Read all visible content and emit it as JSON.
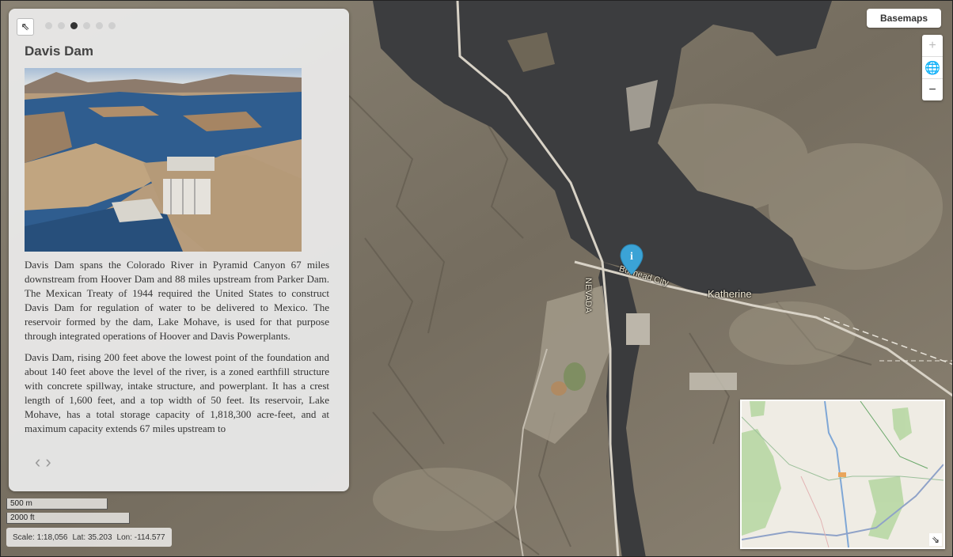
{
  "story": {
    "title": "Davis Dam",
    "paragraphs": [
      "Davis Dam spans the Colorado River in Pyramid Canyon 67 miles downstream from Hoover Dam and 88 miles upstream from Parker Dam. The Mexican Treaty of 1944 required the United States to construct Davis Dam for regulation of water to be delivered to Mexico. The reservoir formed by the dam, Lake Mohave, is used for that purpose through integrated operations of Hoover and Davis Powerplants.",
      "Davis Dam, rising 200 feet above the lowest point of the foundation and about 140 feet above the level of the river, is a zoned earthfill structure with concrete spillway, intake structure, and powerplant. It has a crest length of 1,600 feet, and a top width of 50 feet. Its reservoir, Lake Mohave, has a total storage capacity of 1,818,300 acre-feet, and at maximum capacity extends 67 miles upstream to"
    ],
    "pager": {
      "prev": "‹",
      "next": "›"
    },
    "page_dots": {
      "count": 6,
      "active_index": 2
    }
  },
  "controls": {
    "basemaps_label": "Basemaps",
    "zoom_in": "+",
    "home": "🌐",
    "zoom_out": "−"
  },
  "scale": {
    "metric": "500 m",
    "imperial": "2000 ft",
    "scale_text": "Scale: 1:18,056",
    "lat_text": "Lat: 35.203",
    "lon_text": "Lon: -114.577"
  },
  "map_labels": {
    "state": "NEVADA",
    "road": "Bullhead City",
    "place": "Katherine",
    "marker_glyph": "i"
  },
  "icons": {
    "collapse": "arrow-up-left-icon",
    "overview_toggle": "arrow-down-right-icon",
    "marker": "info-marker-icon"
  },
  "colors": {
    "marker": "#3ba3d6",
    "water": "#3c3d3f",
    "land": "#7a7264"
  }
}
